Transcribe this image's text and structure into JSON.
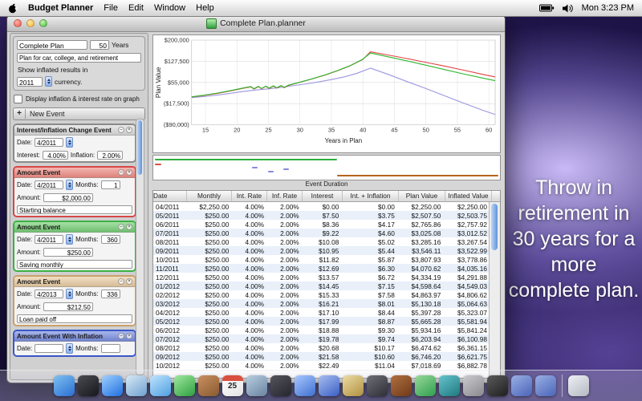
{
  "menu_bar": {
    "app_name": "Budget Planner",
    "menus": [
      "File",
      "Edit",
      "Window",
      "Help"
    ],
    "clock": "Mon 3:23 PM"
  },
  "window": {
    "title": "Complete Plan.planner"
  },
  "sidebar": {
    "plan_name": "Complete Plan",
    "years_value": "50",
    "years_label": "Years",
    "plan_description": "Plan for car, college, and retirement",
    "inflated_results_label": "Show inflated results in",
    "inflated_year": "2011",
    "currency_label": "currency.",
    "graph_checkbox_label": "Display inflation & interest rate on graph",
    "new_event_plus": "+",
    "new_event_label": "New Event",
    "events": [
      {
        "title": "Interest/Inflation Change Event",
        "color": "#8a8a8a",
        "header": "#dcdcdc",
        "date_label": "Date:",
        "date": "4/2011",
        "interest_label": "Interest:",
        "interest": "4.00%",
        "inflation_label": "Inflation:",
        "inflation": "2.00%"
      },
      {
        "title": "Amount Event",
        "color": "#d54747",
        "header": "#ef8e86",
        "date_label": "Date:",
        "date": "4/2011",
        "months_label": "Months:",
        "months": "1",
        "amount_label": "Amount:",
        "amount": "$2,000.00",
        "note": "Starting balance"
      },
      {
        "title": "Amount Event",
        "color": "#3cb043",
        "header": "#79cf79",
        "date_label": "Date:",
        "date": "4/2011",
        "months_label": "Months:",
        "months": "360",
        "amount_label": "Amount:",
        "amount": "$250.00",
        "note": "Saving monthly"
      },
      {
        "title": "Amount Event",
        "color": "#c9a06a",
        "header": "#e9cda4",
        "date_label": "Date:",
        "date": "4/2013",
        "months_label": "Months:",
        "months": "336",
        "amount_label": "Amount:",
        "amount": "$212.50",
        "note": "Loan paid off"
      },
      {
        "title": "Amount Event With Inflation",
        "color": "#3a57c9",
        "header": "#7b8fe0",
        "date_label": "Date:",
        "date": "",
        "months_label": "Months:",
        "months": ""
      }
    ]
  },
  "chart_data": {
    "type": "line",
    "title": "",
    "xlabel": "Years in Plan",
    "ylabel": "Plan Value",
    "x_ticks": [
      15,
      20,
      25,
      30,
      35,
      40,
      45,
      50,
      55,
      60
    ],
    "x_range": [
      12.8,
      61
    ],
    "y_range": [
      -90000,
      200000
    ],
    "y_ticks": [
      {
        "label": "$200,000",
        "value": 200000
      },
      {
        "label": "$127,500",
        "value": 127500
      },
      {
        "label": "$55,000",
        "value": 55000
      },
      {
        "label": "($17,500)",
        "value": -17500
      },
      {
        "label": "($90,000)",
        "value": -90000
      }
    ],
    "grid": true,
    "legend": "none",
    "series": [
      {
        "name": "purple-line (inflated value)",
        "color": "#9a96e0",
        "points": [
          [
            12.8,
            3000
          ],
          [
            15,
            7000
          ],
          [
            17,
            12000
          ],
          [
            19,
            18000
          ],
          [
            21,
            24000
          ],
          [
            23,
            29000
          ],
          [
            25,
            33000
          ],
          [
            27,
            38000
          ],
          [
            29,
            44000
          ],
          [
            31,
            50000
          ],
          [
            33,
            57000
          ],
          [
            35,
            65000
          ],
          [
            37,
            74000
          ],
          [
            39,
            86000
          ],
          [
            41.2,
            104000
          ],
          [
            44,
            83000
          ],
          [
            47,
            58000
          ],
          [
            50,
            34000
          ],
          [
            53,
            9000
          ],
          [
            56,
            -16000
          ],
          [
            59,
            -40000
          ],
          [
            61,
            -55000
          ]
        ]
      },
      {
        "name": "red-line (plan value)",
        "color": "#e04343",
        "points": [
          [
            12.8,
            5000
          ],
          [
            15,
            11000
          ],
          [
            17,
            18000
          ],
          [
            19,
            26000
          ],
          [
            21,
            35000
          ],
          [
            22.2,
            40000
          ],
          [
            22.7,
            32500
          ],
          [
            23.4,
            40500
          ],
          [
            23.9,
            33500
          ],
          [
            24.6,
            41500
          ],
          [
            25.1,
            34500
          ],
          [
            25.8,
            42500
          ],
          [
            26.3,
            35500
          ],
          [
            27,
            43500
          ],
          [
            27.5,
            37000
          ],
          [
            28.2,
            45000
          ],
          [
            30,
            55500
          ],
          [
            32,
            67500
          ],
          [
            34,
            80500
          ],
          [
            36,
            95500
          ],
          [
            38,
            112500
          ],
          [
            40,
            134000
          ],
          [
            41.2,
            160000
          ],
          [
            44,
            149000
          ],
          [
            47,
            137000
          ],
          [
            50,
            124000
          ],
          [
            53,
            111000
          ],
          [
            56,
            97000
          ],
          [
            59,
            83000
          ],
          [
            61,
            74000
          ]
        ]
      },
      {
        "name": "green-line (plan value)",
        "color": "#2db82d",
        "points": [
          [
            12.8,
            6000
          ],
          [
            15,
            12000
          ],
          [
            17,
            19000
          ],
          [
            19,
            27000
          ],
          [
            21,
            36000
          ],
          [
            22.2,
            41000
          ],
          [
            22.7,
            33500
          ],
          [
            23.4,
            41500
          ],
          [
            23.9,
            34500
          ],
          [
            24.6,
            42500
          ],
          [
            25.1,
            35500
          ],
          [
            25.8,
            43500
          ],
          [
            26.3,
            36500
          ],
          [
            27,
            44500
          ],
          [
            27.5,
            38000
          ],
          [
            28.2,
            46000
          ],
          [
            30,
            56000
          ],
          [
            32,
            68000
          ],
          [
            34,
            81000
          ],
          [
            36,
            96000
          ],
          [
            38,
            113000
          ],
          [
            40,
            135000
          ],
          [
            41.2,
            156000
          ],
          [
            44,
            143000
          ],
          [
            47,
            129000
          ],
          [
            50,
            114000
          ],
          [
            53,
            99000
          ],
          [
            56,
            84000
          ],
          [
            59,
            70000
          ],
          [
            61,
            61000
          ]
        ]
      }
    ]
  },
  "event_duration": {
    "label": "Event Duration",
    "bars": [
      {
        "color": "#2fae3f",
        "x1": 0.005,
        "x2": 0.53,
        "y": 0.12
      },
      {
        "color": "#d94f3f",
        "x1": 0.005,
        "x2": 0.022,
        "y": 0.32
      },
      {
        "color": "#8888dd",
        "x1": 0.285,
        "x2": 0.302,
        "y": 0.46
      },
      {
        "color": "#8888dd",
        "x1": 0.33,
        "x2": 0.347,
        "y": 0.64
      },
      {
        "color": "#8888dd",
        "x1": 0.375,
        "x2": 0.392,
        "y": 0.52
      },
      {
        "color": "#b5651d",
        "x1": 0.53,
        "x2": 0.995,
        "y": 0.8
      }
    ]
  },
  "table": {
    "columns": [
      "Date",
      "Monthly",
      "Int. Rate",
      "Inf. Rate",
      "Interest",
      "Int. + Inflation",
      "Plan Value",
      "Inflated Value"
    ],
    "rows": [
      [
        "04/2011",
        "$2,250.00",
        "4.00%",
        "2.00%",
        "$0.00",
        "$0.00",
        "$2,250.00",
        "$2,250.00"
      ],
      [
        "05/2011",
        "$250.00",
        "4.00%",
        "2.00%",
        "$7.50",
        "$3.75",
        "$2,507.50",
        "$2,503.75"
      ],
      [
        "06/2011",
        "$250.00",
        "4.00%",
        "2.00%",
        "$8.36",
        "$4.17",
        "$2,765.86",
        "$2,757.92"
      ],
      [
        "07/2011",
        "$250.00",
        "4.00%",
        "2.00%",
        "$9.22",
        "$4.60",
        "$3,025.08",
        "$3,012.52"
      ],
      [
        "08/2011",
        "$250.00",
        "4.00%",
        "2.00%",
        "$10.08",
        "$5.02",
        "$3,285.16",
        "$3,267.54"
      ],
      [
        "09/2011",
        "$250.00",
        "4.00%",
        "2.00%",
        "$10.95",
        "$5.44",
        "$3,546.11",
        "$3,522.99"
      ],
      [
        "10/2011",
        "$250.00",
        "4.00%",
        "2.00%",
        "$11.82",
        "$5.87",
        "$3,807.93",
        "$3,778.86"
      ],
      [
        "11/2011",
        "$250.00",
        "4.00%",
        "2.00%",
        "$12.69",
        "$6.30",
        "$4,070.62",
        "$4,035.16"
      ],
      [
        "12/2011",
        "$250.00",
        "4.00%",
        "2.00%",
        "$13.57",
        "$6.72",
        "$4,334.19",
        "$4,291.88"
      ],
      [
        "01/2012",
        "$250.00",
        "4.00%",
        "2.00%",
        "$14.45",
        "$7.15",
        "$4,598.64",
        "$4,549.03"
      ],
      [
        "02/2012",
        "$250.00",
        "4.00%",
        "2.00%",
        "$15.33",
        "$7.58",
        "$4,863.97",
        "$4,806.62"
      ],
      [
        "03/2012",
        "$250.00",
        "4.00%",
        "2.00%",
        "$16.21",
        "$8.01",
        "$5,130.18",
        "$5,064.63"
      ],
      [
        "04/2012",
        "$250.00",
        "4.00%",
        "2.00%",
        "$17.10",
        "$8.44",
        "$5,397.28",
        "$5,323.07"
      ],
      [
        "05/2012",
        "$250.00",
        "4.00%",
        "2.00%",
        "$17.99",
        "$8.87",
        "$5,665.28",
        "$5,581.94"
      ],
      [
        "06/2012",
        "$250.00",
        "4.00%",
        "2.00%",
        "$18.88",
        "$9.30",
        "$5,934.16",
        "$5,841.24"
      ],
      [
        "07/2012",
        "$250.00",
        "4.00%",
        "2.00%",
        "$19.78",
        "$9.74",
        "$6,203.94",
        "$6,100.98"
      ],
      [
        "08/2012",
        "$250.00",
        "4.00%",
        "2.00%",
        "$20.68",
        "$10.17",
        "$6,474.62",
        "$6,361.15"
      ],
      [
        "09/2012",
        "$250.00",
        "4.00%",
        "2.00%",
        "$21.58",
        "$10.60",
        "$6,746.20",
        "$6,621.75"
      ],
      [
        "10/2012",
        "$250.00",
        "4.00%",
        "2.00%",
        "$22.49",
        "$11.04",
        "$7,018.69",
        "$6,882.78"
      ]
    ]
  },
  "desktop": {
    "caption": "Throw in retirement in 30 years for a more complete plan."
  },
  "dock": {
    "items": [
      {
        "name": "finder",
        "c1": "#7ec0f0",
        "c2": "#2a6fd4",
        "glyph": ""
      },
      {
        "name": "dashboard",
        "c1": "#4a4a52",
        "c2": "#17171c",
        "glyph": ""
      },
      {
        "name": "safari",
        "c1": "#9fd0ff",
        "c2": "#1f6fe0",
        "glyph": ""
      },
      {
        "name": "mail",
        "c1": "#d8e9f6",
        "c2": "#6fa0cf",
        "glyph": ""
      },
      {
        "name": "ichat",
        "c1": "#bfe4ff",
        "c2": "#4f9fe0",
        "glyph": ""
      },
      {
        "name": "facetime",
        "c1": "#9fe89f",
        "c2": "#2f9f3f",
        "glyph": ""
      },
      {
        "name": "address-book",
        "c1": "#c89060",
        "c2": "#8a5a30",
        "glyph": ""
      },
      {
        "name": "ical",
        "c1": "#ffffff",
        "c2": "#e3e3e3",
        "glyph": "25",
        "glyph_color": "#222",
        "top": "#d94f3f"
      },
      {
        "name": "preview",
        "c1": "#b8cde0",
        "c2": "#6a84a0",
        "glyph": ""
      },
      {
        "name": "photo-booth",
        "c1": "#55555f",
        "c2": "#25252d",
        "glyph": ""
      },
      {
        "name": "itunes",
        "c1": "#a8c8ff",
        "c2": "#3f6fd0",
        "glyph": ""
      },
      {
        "name": "app-store",
        "c1": "#a8bef0",
        "c2": "#3a5fc4",
        "glyph": ""
      },
      {
        "name": "iphoto",
        "c1": "#ecdca4",
        "c2": "#b09040",
        "glyph": ""
      },
      {
        "name": "imovie",
        "c1": "#6f6f78",
        "c2": "#2e2e36",
        "glyph": ""
      },
      {
        "name": "garageband",
        "c1": "#b07040",
        "c2": "#6f3a18",
        "glyph": ""
      },
      {
        "name": "budget-planner",
        "c1": "#98d898",
        "c2": "#2f9f4f",
        "glyph": ""
      },
      {
        "name": "time-machine",
        "c1": "#66c4cc",
        "c2": "#1f7880",
        "glyph": ""
      },
      {
        "name": "system-preferences",
        "c1": "#cccccf",
        "c2": "#88888e",
        "glyph": ""
      },
      {
        "name": "terminal",
        "c1": "#5a5a5a",
        "c2": "#1f1f1f",
        "glyph": ""
      },
      {
        "name": "documents-folder",
        "c1": "#9ab0e4",
        "c2": "#4a64b8",
        "glyph": ""
      },
      {
        "name": "applications-folder",
        "c1": "#9ab0e4",
        "c2": "#4a64b8",
        "glyph": ""
      },
      {
        "name": "separator",
        "sep": true
      },
      {
        "name": "trash",
        "c1": "#eef0f4",
        "c2": "#b4b8c2",
        "glyph": ""
      }
    ]
  }
}
